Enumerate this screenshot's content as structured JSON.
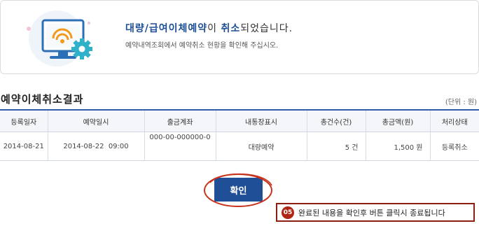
{
  "notice": {
    "title_part1": "대량/급여이체예약",
    "title_part2": "이 ",
    "title_part3": "취소",
    "title_part4": "되었습니다.",
    "subtitle": "예약내역조회에서 예약취소 현황을 확인해 주십시오.",
    "illustration_icon": "monitor-wifi-gear-icon",
    "colors": {
      "highlight": "#1d4f97",
      "gear": "#2fb1c9"
    }
  },
  "section": {
    "title": "예약이체취소결과",
    "unit": "(단위 : 원)"
  },
  "table": {
    "headers": [
      "등록일자",
      "예약일시",
      "출금계좌",
      "내통장표시",
      "총건수(건)",
      "총금액(원)",
      "처리상태"
    ],
    "rows": [
      [
        "2014-08-21",
        "2014-08-22  09:00",
        "000-00-000000-0",
        "대량예약",
        "5 건",
        "1,500 원",
        "등록취소"
      ]
    ]
  },
  "actions": {
    "confirm_label": "확인"
  },
  "guide": {
    "step": "05",
    "text": "완료된 내용을 확인후 버튼 클릭시 종료됩니다"
  }
}
